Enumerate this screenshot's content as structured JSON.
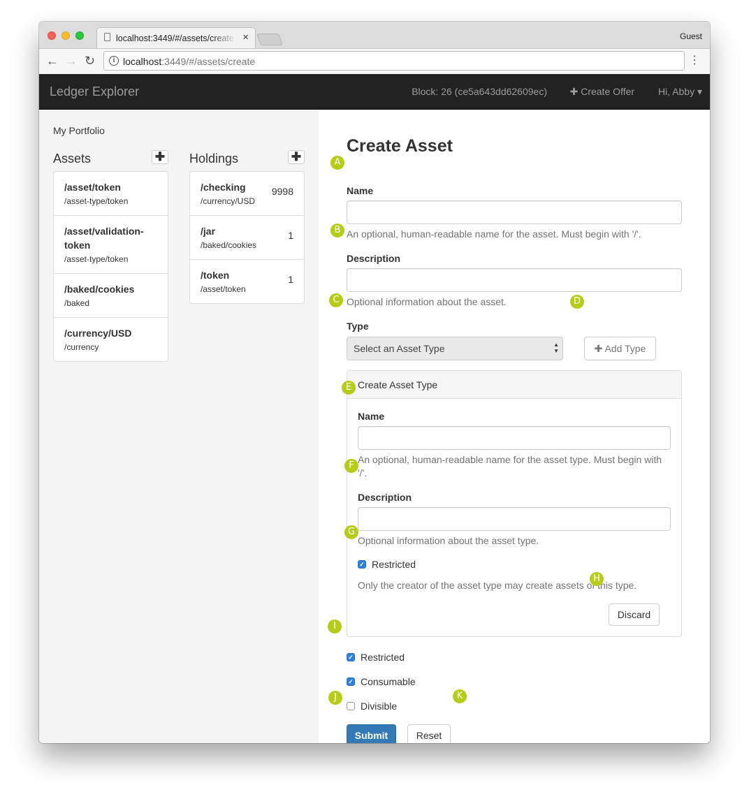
{
  "browser": {
    "tab_title": "localhost:3449/#/assets/create",
    "tab_close": "×",
    "profile": "Guest",
    "url_host": "localhost",
    "url_path": ":3449/#/assets/create",
    "info_glyph": "i",
    "back_glyph": "←",
    "forward_glyph": "→",
    "reload_glyph": "↻",
    "menu_glyph": "⋮"
  },
  "navbar": {
    "brand": "Ledger Explorer",
    "block": "Block: 26 (ce5a643dd62609ec)",
    "create_offer": "✚ Create Offer",
    "user": "Hi, Abby ▾"
  },
  "sidebar": {
    "heading": "My Portfolio",
    "plus_glyph": "✚",
    "assets": {
      "title": "Assets",
      "items": [
        {
          "name": "/asset/token",
          "type": "/asset-type/token"
        },
        {
          "name": "/asset/validation-token",
          "type": "/asset-type/token"
        },
        {
          "name": "/baked/cookies",
          "type": "/baked"
        },
        {
          "name": "/currency/USD",
          "type": "/currency"
        }
      ]
    },
    "holdings": {
      "title": "Holdings",
      "items": [
        {
          "name": "/checking",
          "asset": "/currency/USD",
          "amount": "9998"
        },
        {
          "name": "/jar",
          "asset": "/baked/cookies",
          "amount": "1"
        },
        {
          "name": "/token",
          "asset": "/asset/token",
          "amount": "1"
        }
      ]
    }
  },
  "form": {
    "title": "Create Asset",
    "name_label": "Name",
    "name_value": "",
    "name_help": "An optional, human-readable name for the asset. Must begin with '/'.",
    "description_label": "Description",
    "description_value": "",
    "description_help": "Optional information about the asset.",
    "type_label": "Type",
    "type_selected": "Select an Asset Type",
    "add_type_label": "✚ Add Type",
    "panel": {
      "heading": "Create Asset Type",
      "name_label": "Name",
      "name_value": "",
      "name_help": "An optional, human-readable name for the asset type. Must begin with '/'.",
      "description_label": "Description",
      "description_value": "",
      "description_help": "Optional information about the asset type.",
      "restricted_label": "Restricted",
      "restricted_checked": true,
      "restricted_help": "Only the creator of the asset type may create assets of this type.",
      "discard_label": "Discard"
    },
    "restricted_label": "Restricted",
    "restricted_checked": true,
    "consumable_label": "Consumable",
    "consumable_checked": true,
    "divisible_label": "Divisible",
    "divisible_checked": false,
    "submit_label": "Submit",
    "reset_label": "Reset"
  },
  "annotations": [
    "A",
    "B",
    "C",
    "D",
    "E",
    "F",
    "G",
    "H",
    "I",
    "J",
    "K"
  ],
  "colors": {
    "navbar_bg": "#222222",
    "sidebar_bg": "#f4f4f4",
    "primary": "#337ab7",
    "badge": "#b5cc18",
    "checkbox": "#2f7fe0"
  },
  "icons": {
    "check": "✓",
    "select_arrows": "▲▼"
  }
}
